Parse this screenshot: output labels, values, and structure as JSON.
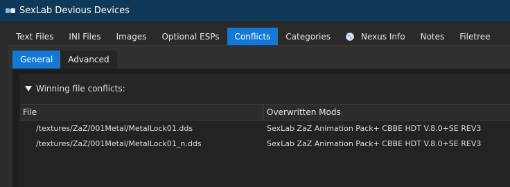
{
  "window": {
    "title": "SexLab Devious Devices"
  },
  "tabs": [
    {
      "label": "Text Files"
    },
    {
      "label": "INI Files"
    },
    {
      "label": "Images"
    },
    {
      "label": "Optional ESPs"
    },
    {
      "label": "Conflicts",
      "active": true
    },
    {
      "label": "Categories"
    },
    {
      "label": "Nexus Info",
      "icon": "globe-icon"
    },
    {
      "label": "Notes"
    },
    {
      "label": "Filetree"
    }
  ],
  "subtabs": [
    {
      "label": "General",
      "active": true
    },
    {
      "label": "Advanced"
    }
  ],
  "conflicts": {
    "section_label": "Winning file conflicts:",
    "columns": {
      "file": "File",
      "mods": "Overwritten Mods"
    },
    "rows": [
      {
        "file": "/textures/ZaZ/001Metal/MetalLock01.dds",
        "mods": "SexLab ZaZ Animation Pack+ CBBE HDT V.8.0+SE REV3"
      },
      {
        "file": "/textures/ZaZ/001Metal/MetalLock01_n.dds",
        "mods": "SexLab ZaZ Animation Pack+ CBBE HDT V.8.0+SE REV3"
      }
    ]
  },
  "colors": {
    "accent": "#1478d4",
    "titlebar": "#0f3a57",
    "background": "#2a2a2a"
  }
}
